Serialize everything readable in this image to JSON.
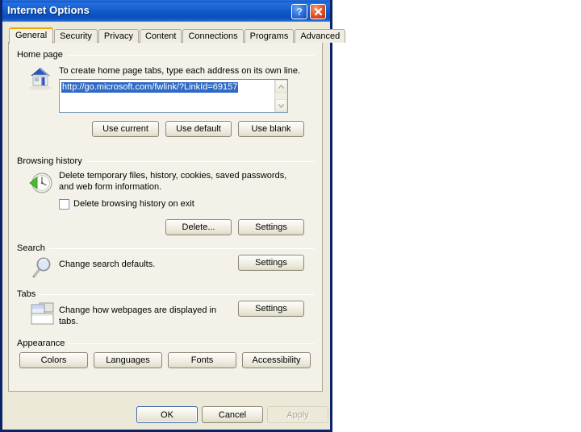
{
  "window": {
    "title": "Internet Options",
    "help_button": "?",
    "close_button": "✕"
  },
  "tabs": [
    {
      "label": "General",
      "active": true
    },
    {
      "label": "Security",
      "active": false
    },
    {
      "label": "Privacy",
      "active": false
    },
    {
      "label": "Content",
      "active": false
    },
    {
      "label": "Connections",
      "active": false
    },
    {
      "label": "Programs",
      "active": false
    },
    {
      "label": "Advanced",
      "active": false
    }
  ],
  "home_page": {
    "group_label": "Home page",
    "icon": "house-icon",
    "description": "To create home page tabs, type each address on its own line.",
    "value": "http://go.microsoft.com/fwlink/?LinkId=69157",
    "selected": true,
    "buttons": [
      {
        "label": "Use current"
      },
      {
        "label": "Use default"
      },
      {
        "label": "Use blank"
      }
    ],
    "scrollbar": {
      "up": "▲",
      "down": "▼"
    }
  },
  "browsing_history": {
    "group_label": "Browsing history",
    "icon": "clock-refresh-icon",
    "description": "Delete temporary files, history, cookies, saved passwords, and web form information.",
    "checkbox": {
      "label": "Delete browsing history on exit",
      "checked": false
    },
    "buttons": [
      {
        "label": "Delete..."
      },
      {
        "label": "Settings"
      }
    ]
  },
  "search": {
    "group_label": "Search",
    "icon": "magnifier-icon",
    "description": "Change search defaults.",
    "buttons": [
      {
        "label": "Settings"
      }
    ]
  },
  "tabs_section": {
    "group_label": "Tabs",
    "icon": "tabbed-window-icon",
    "description": "Change how webpages are displayed in tabs.",
    "buttons": [
      {
        "label": "Settings"
      }
    ]
  },
  "appearance": {
    "group_label": "Appearance",
    "buttons": [
      {
        "label": "Colors"
      },
      {
        "label": "Languages"
      },
      {
        "label": "Fonts"
      },
      {
        "label": "Accessibility"
      }
    ]
  },
  "footer": {
    "ok": "OK",
    "cancel": "Cancel",
    "apply": "Apply",
    "apply_disabled": true
  },
  "colors": {
    "titlebar_blue": "#0a5fd4",
    "window_border": "#0a246a",
    "dialog_face": "#ece9d8",
    "panel_face": "#f4f2e8",
    "active_tab_accent": "#f0a800",
    "selection_blue": "#316ac5",
    "group_rule": "#aca899",
    "disabled_text": "#aca899"
  }
}
